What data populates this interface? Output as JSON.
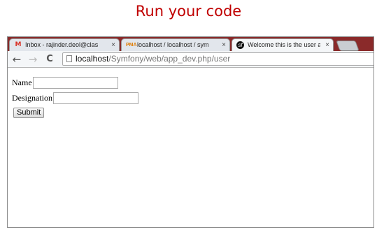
{
  "caption": "Run your code",
  "browser": {
    "tabs": [
      {
        "icon": "gmail-icon",
        "label": "Inbox - rajinder.deol@clas",
        "close": "×",
        "active": false
      },
      {
        "icon": "phpmyadmin-icon",
        "label": "localhost / localhost / sym",
        "close": "×",
        "active": false
      },
      {
        "icon": "symfony-icon",
        "label": "Welcome this is the user a",
        "close": "×",
        "active": true
      }
    ],
    "nav": {
      "back": "←",
      "forward": "→",
      "reload": "C"
    },
    "url": {
      "host": "localhost",
      "path": "/Symfony/web/app_dev.php/user"
    }
  },
  "form": {
    "name_label": "Name",
    "name_value": "",
    "designation_label": "Designation",
    "designation_value": "",
    "submit_label": "Submit"
  },
  "colors": {
    "caption": "#c00000",
    "tabstrip": "#8a2a2a"
  }
}
